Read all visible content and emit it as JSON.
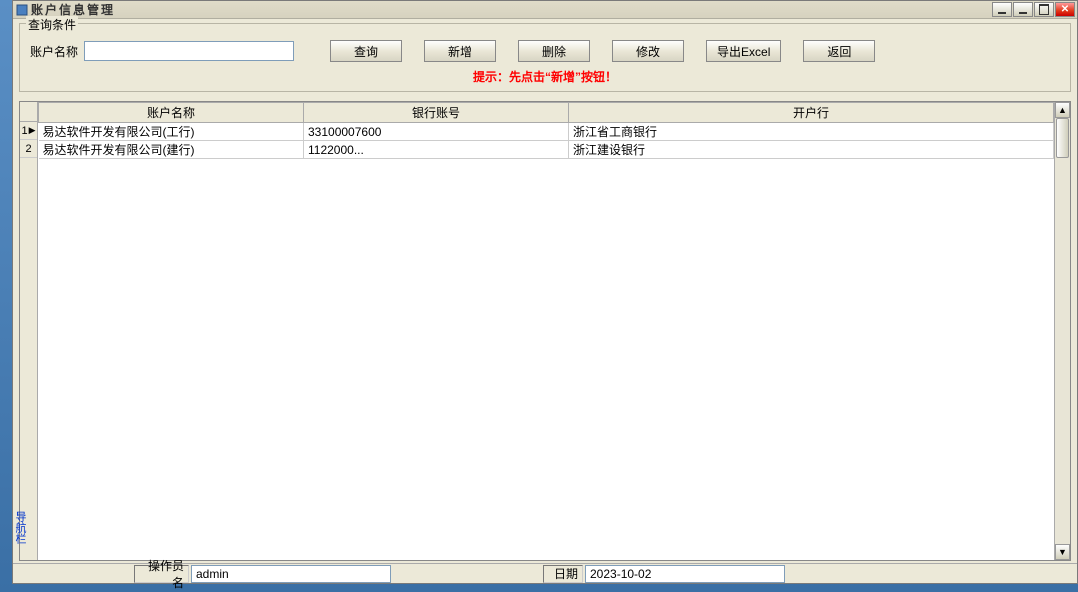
{
  "window": {
    "title": "账户信息管理"
  },
  "query": {
    "group_title": "查询条件",
    "label_account_name": "账户名称",
    "value_account_name": ""
  },
  "buttons": {
    "search": "查询",
    "add": "新增",
    "delete": "删除",
    "edit": "修改",
    "export": "导出Excel",
    "back": "返回"
  },
  "hint": "提示：先点击“新增”按钮！",
  "table": {
    "headers": [
      "账户名称",
      "银行账号",
      "开户行"
    ],
    "rows": [
      {
        "idx": "1",
        "current": true,
        "cells": [
          "易达软件开发有限公司(工行)",
          "33100007600",
          "浙江省工商银行"
        ]
      },
      {
        "idx": "2",
        "current": false,
        "cells": [
          "易达软件开发有限公司(建行)",
          "1122000...",
          "浙江建设银行"
        ]
      }
    ]
  },
  "status": {
    "operator_label": "操作员名",
    "operator_value": "admin",
    "date_label": "日期",
    "date_value": "2023-10-02"
  },
  "side_tab": "导航栏"
}
